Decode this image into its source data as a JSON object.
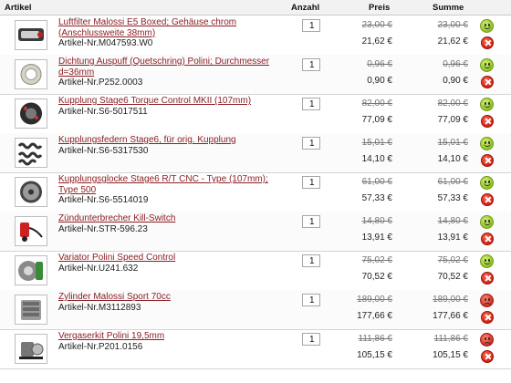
{
  "header": {
    "artikel": "Artikel",
    "anzahl": "Anzahl",
    "preis": "Preis",
    "summe": "Summe"
  },
  "items": [
    {
      "name": "Luftfilter Malossi E5 Boxed; Gehäuse chrom (Anschlussweite 38mm)",
      "artno": "Artikel-Nr.M047593.W0",
      "qty": "1",
      "price_old": "23,00 €",
      "price_new": "21,62 €",
      "sum_old": "23,00 €",
      "sum_new": "21,62 €",
      "availability": "green",
      "lines": 2
    },
    {
      "name": "Dichtung Auspuff (Quetschring) Polini; Durchmesser d=36mm",
      "artno": "Artikel-Nr.P252.0003",
      "qty": "1",
      "price_old": "0,96 €",
      "price_new": "0,90 €",
      "sum_old": "0,96 €",
      "sum_new": "0,90 €",
      "availability": "green",
      "lines": 2
    },
    {
      "name": "Kupplung Stage6 Torque Control MKII (107mm)",
      "artno": "Artikel-Nr.S6-5017511",
      "qty": "1",
      "price_old": "82,00 €",
      "price_new": "77,09 €",
      "sum_old": "82,00 €",
      "sum_new": "77,09 €",
      "availability": "green",
      "lines": 1
    },
    {
      "name": "Kupplungsfedern Stage6, für orig. Kupplung",
      "artno": "Artikel-Nr.S6-5317530",
      "qty": "1",
      "price_old": "15,01 €",
      "price_new": "14,10 €",
      "sum_old": "15,01 €",
      "sum_new": "14,10 €",
      "availability": "green",
      "lines": 1
    },
    {
      "name": "Kupplungsglocke Stage6 R/T CNC - Type (107mm); Type 500",
      "artno": "Artikel-Nr.S6-5514019",
      "qty": "1",
      "price_old": "61,00 €",
      "price_new": "57,33 €",
      "sum_old": "61,00 €",
      "sum_new": "57,33 €",
      "availability": "green",
      "lines": 2
    },
    {
      "name": "Zündunterbrecher Kill-Switch",
      "artno": "Artikel-Nr.STR-596.23",
      "qty": "1",
      "price_old": "14,80 €",
      "price_new": "13,91 €",
      "sum_old": "14,80 €",
      "sum_new": "13,91 €",
      "availability": "green",
      "lines": 1
    },
    {
      "name": "Variator Polini Speed Control",
      "artno": "Artikel-Nr.U241.632",
      "qty": "1",
      "price_old": "75,02 €",
      "price_new": "70,52 €",
      "sum_old": "75,02 €",
      "sum_new": "70,52 €",
      "availability": "green",
      "lines": 1
    },
    {
      "name": "Zylinder Malossi Sport 70cc",
      "artno": "Artikel-Nr.M3112893",
      "qty": "1",
      "price_old": "189,00 €",
      "price_new": "177,66 €",
      "sum_old": "189,00 €",
      "sum_new": "177,66 €",
      "availability": "red",
      "lines": 1
    },
    {
      "name": "Vergaserkit Polini 19,5mm",
      "artno": "Artikel-Nr.P201.0156",
      "qty": "1",
      "price_old": "111,86 €",
      "price_new": "105,15 €",
      "sum_old": "111,86 €",
      "sum_new": "105,15 €",
      "availability": "red",
      "lines": 1
    }
  ],
  "colors": {
    "link": "#8b1f24",
    "available": "#8cc21e",
    "unavailable": "#d42a18"
  }
}
